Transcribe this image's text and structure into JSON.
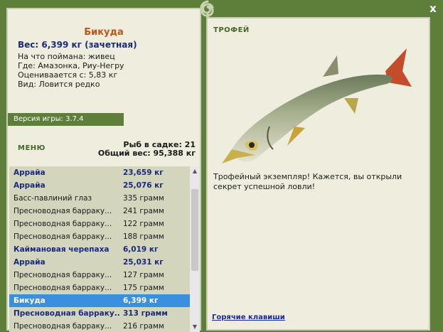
{
  "window": {
    "close_label": "x"
  },
  "fish": {
    "name": "Бикуда",
    "weight_line": "Вес: 6,399 кг (зачетная)",
    "bait_line": "На что поймана: живец",
    "location_line": "Где: Амазонка, Риу-Негру",
    "value_line": "Оцениваается с: 5,83 кг",
    "kind_line": "Вид: Ловится редко"
  },
  "version": "Версия игры: 3.7.4",
  "menu_label": "МЕНЮ",
  "cage": {
    "count_line": "Рыб в садке: 21",
    "total_line": "Общий вес: 95,388 кг"
  },
  "catch_list": [
    {
      "name": "Аррайа",
      "weight": "23,659 кг",
      "bold": true,
      "selected": false
    },
    {
      "name": "Аррайа",
      "weight": "25,076 кг",
      "bold": true,
      "selected": false
    },
    {
      "name": "Басс-павлиний глаз",
      "weight": "335 грамм",
      "bold": false,
      "selected": false
    },
    {
      "name": "Пресноводная барраку...",
      "weight": "241 грамм",
      "bold": false,
      "selected": false
    },
    {
      "name": "Пресноводная барраку...",
      "weight": "122 грамм",
      "bold": false,
      "selected": false
    },
    {
      "name": "Пресноводная барраку...",
      "weight": "188 грамм",
      "bold": false,
      "selected": false
    },
    {
      "name": "Каймановая черепаха",
      "weight": "6,019 кг",
      "bold": true,
      "selected": false
    },
    {
      "name": "Аррайа",
      "weight": "25,031 кг",
      "bold": true,
      "selected": false
    },
    {
      "name": "Пресноводная барраку...",
      "weight": "127 грамм",
      "bold": false,
      "selected": false
    },
    {
      "name": "Пресноводная барраку...",
      "weight": "175 грамм",
      "bold": false,
      "selected": false
    },
    {
      "name": "Бикуда",
      "weight": "6,399 кг",
      "bold": true,
      "selected": true
    },
    {
      "name": "Пресноводная барраку...",
      "weight": "313 грамм",
      "bold": true,
      "selected": false
    },
    {
      "name": "Пресноводная барраку...",
      "weight": "216 грамм",
      "bold": false,
      "selected": false
    }
  ],
  "trophy": {
    "label": "ТРОФЕЙ",
    "text": "Трофейный экземпляр! Кажется, вы открыли секрет успешной ловли!"
  },
  "hotkeys_label": "Горячие клавиши",
  "icons": {
    "close": "close-icon",
    "fish": "fish-image",
    "scroll_up": "arrow-up-icon",
    "scroll_down": "arrow-down-icon"
  },
  "colors": {
    "frame": "#5e7f3a",
    "panel": "#efeede",
    "list_bg": "#d3d5bc",
    "selection": "#3a8fde",
    "name_orange": "#c0551a",
    "bold_blue": "#1a2a7a"
  }
}
